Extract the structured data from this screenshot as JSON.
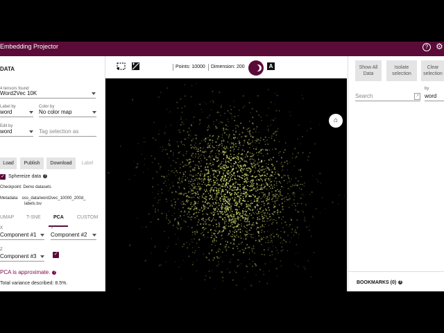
{
  "app": {
    "title": "Embedding Projector"
  },
  "data_panel": {
    "section_title": "DATA",
    "tensors_label": "4 tensors found",
    "tensor_value": "Word2Vec 10K",
    "label_by_label": "Label by",
    "label_by_value": "word",
    "color_by_label": "Color by",
    "color_by_value": "No color map",
    "edit_by_label": "Edit by",
    "edit_by_value": "word",
    "tag_placeholder": "Tag selection as",
    "buttons": {
      "load": "Load",
      "publish": "Publish",
      "download": "Download",
      "label": "Label"
    },
    "sphereize_label": "Sphereize data",
    "checkpoint": "Checkpoint: Demo datasets",
    "metadata_line1": "Metadata:   oss_data/word2vec_10000_200d_",
    "metadata_line2": "labels.tsv"
  },
  "projection_tabs": [
    {
      "label": "UMAP"
    },
    {
      "label": "T-SNE"
    },
    {
      "label": "PCA"
    },
    {
      "label": "CUSTOM"
    }
  ],
  "pca": {
    "x_label": "X",
    "x_value": "Component #1",
    "y_label": "Y",
    "y_value": "Component #2",
    "z_label": "Z",
    "z_value": "Component #3",
    "approx_text": "PCA is approximate.",
    "variance_text": "Total variance described: 8.5%."
  },
  "toolbar": {
    "points": "Points: 10000",
    "dimension": "Dimension: 200",
    "label_icon_letter": "A"
  },
  "inspector": {
    "show_all": [
      "Show All",
      "Data"
    ],
    "isolate": [
      "Isolate",
      "selection"
    ],
    "clear": [
      "Clear",
      "selection"
    ],
    "search_placeholder": "Search",
    "by_label": "by",
    "by_value": "word",
    "bookmarks": "BOOKMARKS (0)"
  },
  "colors": {
    "brand": "#5b0b38",
    "point": "#c8cf6a"
  }
}
